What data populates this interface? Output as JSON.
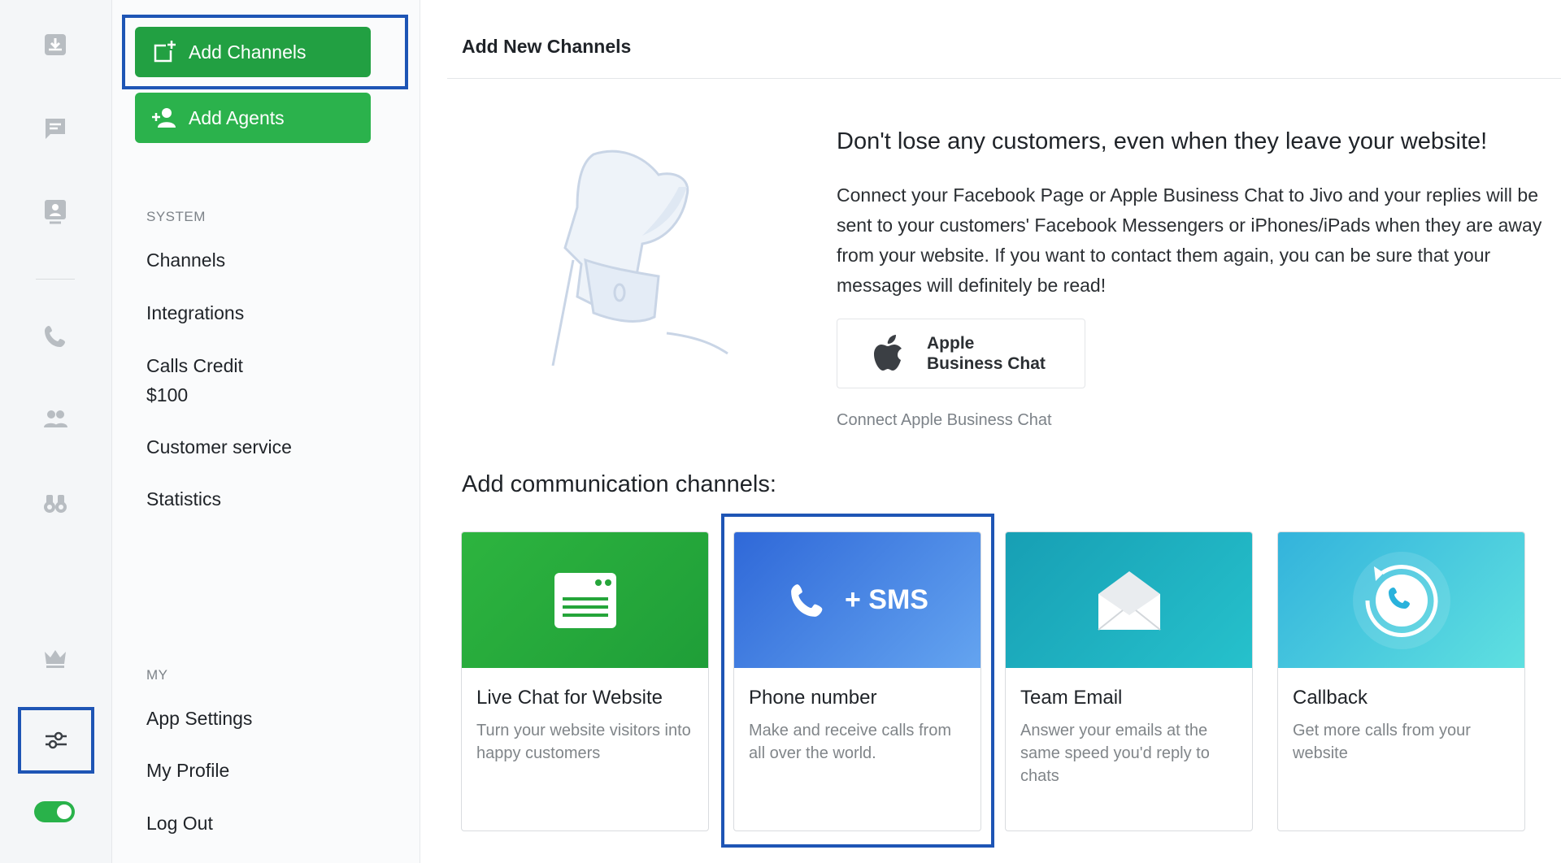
{
  "rail": {
    "icons": [
      "inbox-icon",
      "chat-icon",
      "contact-card-icon",
      "phone-icon",
      "team-icon",
      "binoculars-icon",
      "crown-icon",
      "settings-sliders-icon"
    ],
    "status_toggle_on": true,
    "accent_color": "#2bb24c",
    "highlight_color": "#1e55b5"
  },
  "menu": {
    "add_channels_label": "Add Channels",
    "add_agents_label": "Add Agents",
    "system_label": "SYSTEM",
    "system_items": [
      "Channels",
      "Integrations",
      "Calls Credit",
      "Customer service",
      "Statistics"
    ],
    "calls_credit_amount": "$100",
    "my_label": "MY",
    "my_items": [
      "App Settings",
      "My Profile",
      "Log Out"
    ]
  },
  "main": {
    "title": "Add New Channels",
    "promo": {
      "heading": "Don't lose any customers, even when they leave your website!",
      "text": "Connect your Facebook Page or Apple Business Chat to Jivo and your replies will be sent to your customers' Facebook Messengers or iPhones/iPads when they are away from your website. If you want to contact them again, you can be sure that your messages will definitely be read!",
      "apple_line1": "Apple",
      "apple_line2": "Business Chat",
      "apple_caption": "Connect Apple Business Chat"
    },
    "channels_heading": "Add communication channels:",
    "cards": [
      {
        "title": "Live Chat for Website",
        "desc": "Turn your website visitors into happy customers",
        "icon": "chat-window-icon",
        "color": "#25a53a"
      },
      {
        "title": "Phone number",
        "desc": "Make and receive calls from all over the world.",
        "icon": "phone-icon",
        "badge": "+ SMS",
        "color": "#3f7de0"
      },
      {
        "title": "Team Email",
        "desc": "Answer your emails at the same speed you'd reply to chats",
        "icon": "envelope-icon",
        "color": "#1fb0bf"
      },
      {
        "title": "Callback",
        "desc": "Get more calls from your website",
        "icon": "callback-icon",
        "color": "#3cc4d8"
      }
    ]
  }
}
